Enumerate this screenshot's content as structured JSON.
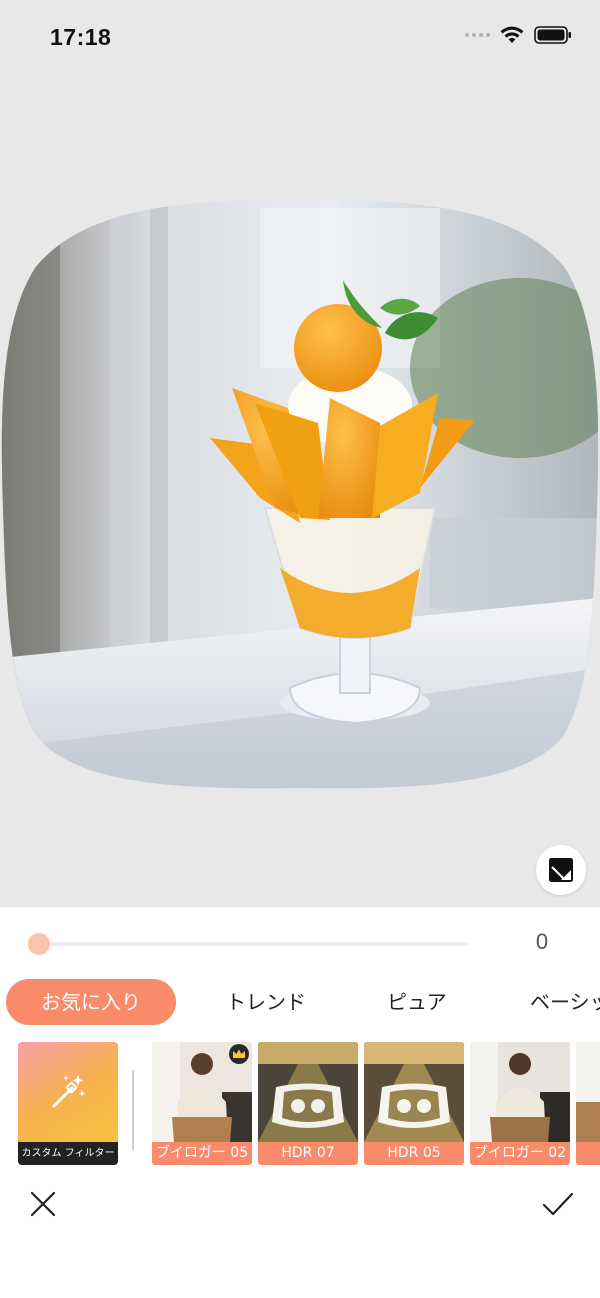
{
  "status_bar": {
    "time": "17:18",
    "icons": [
      "signal-icon",
      "wifi-icon",
      "battery-icon"
    ]
  },
  "editor": {
    "photo": {
      "description_icon": "parfait-photo",
      "shape": "rounded-squircle"
    },
    "compare_icon": "compare-icon"
  },
  "adjust": {
    "slider_value": "0",
    "slider_level": 0
  },
  "tabs": [
    {
      "label": "お気に入り",
      "active": true
    },
    {
      "label": "トレンド",
      "active": false
    },
    {
      "label": "ピュア",
      "active": false
    },
    {
      "label": "ベーシック",
      "active": false
    }
  ],
  "custom_filter": {
    "label": "カスタム フィルター",
    "icon": "magic-wand-icon"
  },
  "filters": [
    {
      "label": "ブイロガー 05",
      "premium": true
    },
    {
      "label": "HDR 07",
      "premium": false
    },
    {
      "label": "HDR 05",
      "premium": false
    },
    {
      "label": "ブイロガー 02",
      "premium": false
    },
    {
      "label": "ブイ",
      "premium": false
    }
  ],
  "actions": {
    "cancel_icon": "close-icon",
    "confirm_icon": "check-icon"
  },
  "colors": {
    "accent": "#f98b6b",
    "slider_thumb": "#f9c4ac",
    "canvas_bg": "#e8e8e8"
  }
}
